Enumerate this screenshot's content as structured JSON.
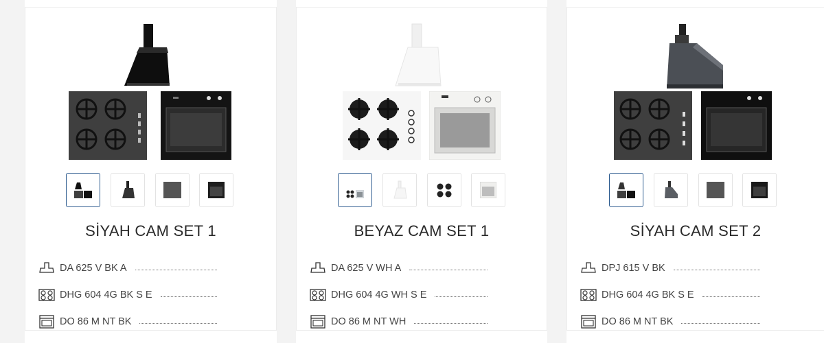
{
  "products": [
    {
      "title": "SİYAH CAM SET 1",
      "variant": "black",
      "accent": "#1c1c1c",
      "hob_color": "#3f3f3f",
      "items": [
        {
          "icon": "hood-icon",
          "code": "DA 625 V BK A"
        },
        {
          "icon": "hob-icon",
          "code": "DHG 604 4G BK S E"
        },
        {
          "icon": "oven-icon",
          "code": "DO 86 M NT BK"
        }
      ]
    },
    {
      "title": "BEYAZ CAM SET 1",
      "variant": "white",
      "accent": "#f4f4f4",
      "hob_color": "#f6f6f6",
      "items": [
        {
          "icon": "hood-icon",
          "code": "DA 625 V WH A"
        },
        {
          "icon": "hob-icon",
          "code": "DHG 604 4G WH S E"
        },
        {
          "icon": "oven-icon",
          "code": "DO 86 M NT WH"
        }
      ]
    },
    {
      "title": "SİYAH CAM SET 2",
      "variant": "black-grey",
      "accent": "#2a2a2a",
      "hob_color": "#3f3f3f",
      "items": [
        {
          "icon": "hood-icon",
          "code": "DPJ 615 V BK"
        },
        {
          "icon": "hob-icon",
          "code": "DHG 604 4G BK S E"
        },
        {
          "icon": "oven-icon",
          "code": "DO 86 M NT BK"
        }
      ]
    }
  ],
  "colors": {
    "active_thumb_border": "#2d5b8f",
    "gutter": "#f3f3f3"
  }
}
